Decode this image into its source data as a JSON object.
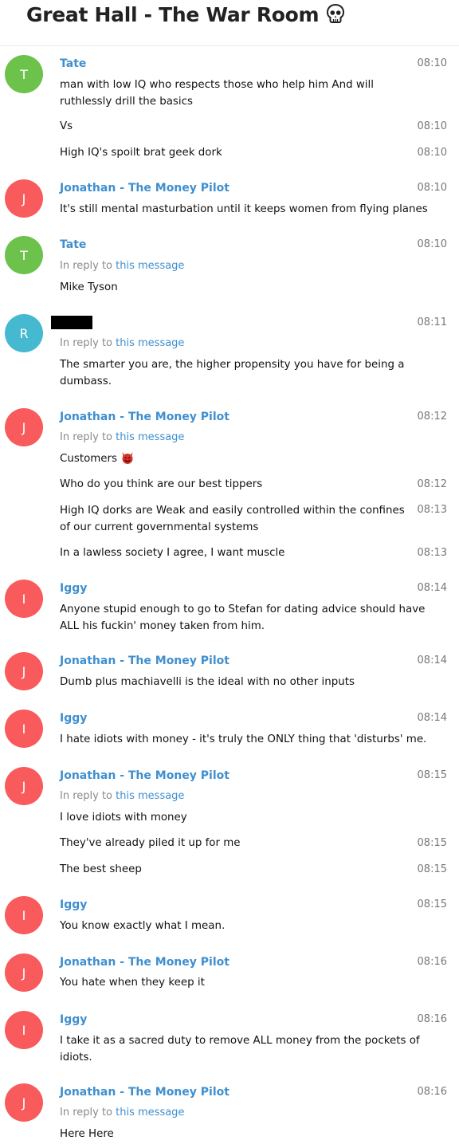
{
  "chat": {
    "title": "Great Hall - The War Room",
    "title_icon": "skull-icon"
  },
  "colors": {
    "link": "#3f8fcf",
    "avatar_green": "#6cc24a",
    "avatar_red": "#f95b5d",
    "avatar_teal": "#45b9cf"
  },
  "reply_prefix": "In reply to",
  "reply_link": "this message",
  "messages": [
    {
      "avatar": "T",
      "sender": "Tate",
      "time": "08:10",
      "text": "man with low IQ who respects those who help him And will ruthlessly drill the basics"
    },
    {
      "time": "08:10",
      "text": "Vs"
    },
    {
      "time": "08:10",
      "text": "High IQ's spoilt brat geek dork"
    },
    {
      "avatar": "J",
      "sender": "Jonathan - The Money Pilot",
      "time": "08:10",
      "text": "It's still mental masturbation until it keeps women from flying planes"
    },
    {
      "avatar": "T",
      "sender": "Tate",
      "time": "08:10",
      "text": "Mike Tyson"
    },
    {
      "avatar": "R",
      "sender": "",
      "time": "08:11",
      "text": "The smarter you are, the higher propensity you have for being a dumbass."
    },
    {
      "avatar": "J",
      "sender": "Jonathan - The Money Pilot",
      "time": "08:12",
      "text": "Customers"
    },
    {
      "time": "08:12",
      "text": "Who do you think are our best tippers"
    },
    {
      "time": "08:13",
      "text": "High IQ dorks are Weak and easily controlled within the confines of our current governmental systems"
    },
    {
      "time": "08:13",
      "text": "In a lawless society I agree, I want muscle"
    },
    {
      "avatar": "I",
      "sender": "Iggy",
      "time": "08:14",
      "text": "Anyone stupid enough to go to Stefan for dating advice should have ALL his fuckin' money taken from him."
    },
    {
      "avatar": "J",
      "sender": "Jonathan - The Money Pilot",
      "time": "08:14",
      "text": "Dumb plus machiavelli is the ideal with no other inputs"
    },
    {
      "avatar": "I",
      "sender": "Iggy",
      "time": "08:14",
      "text": "I hate idiots with money - it's truly the ONLY thing that 'disturbs' me."
    },
    {
      "avatar": "J",
      "sender": "Jonathan - The Money Pilot",
      "time": "08:15",
      "text": "I love idiots with money"
    },
    {
      "time": "08:15",
      "text": "They've already piled it up for me"
    },
    {
      "time": "08:15",
      "text": "The best sheep"
    },
    {
      "avatar": "I",
      "sender": "Iggy",
      "time": "08:15",
      "text": "You know exactly what I mean."
    },
    {
      "avatar": "J",
      "sender": "Jonathan - The Money Pilot",
      "time": "08:16",
      "text": "You hate when they keep it"
    },
    {
      "avatar": "I",
      "sender": "Iggy",
      "time": "08:16",
      "text": "I take it as a sacred duty to remove ALL money from the pockets of idiots."
    },
    {
      "avatar": "J",
      "sender": "Jonathan - The Money Pilot",
      "time": "08:16",
      "text": "Here Here"
    }
  ]
}
